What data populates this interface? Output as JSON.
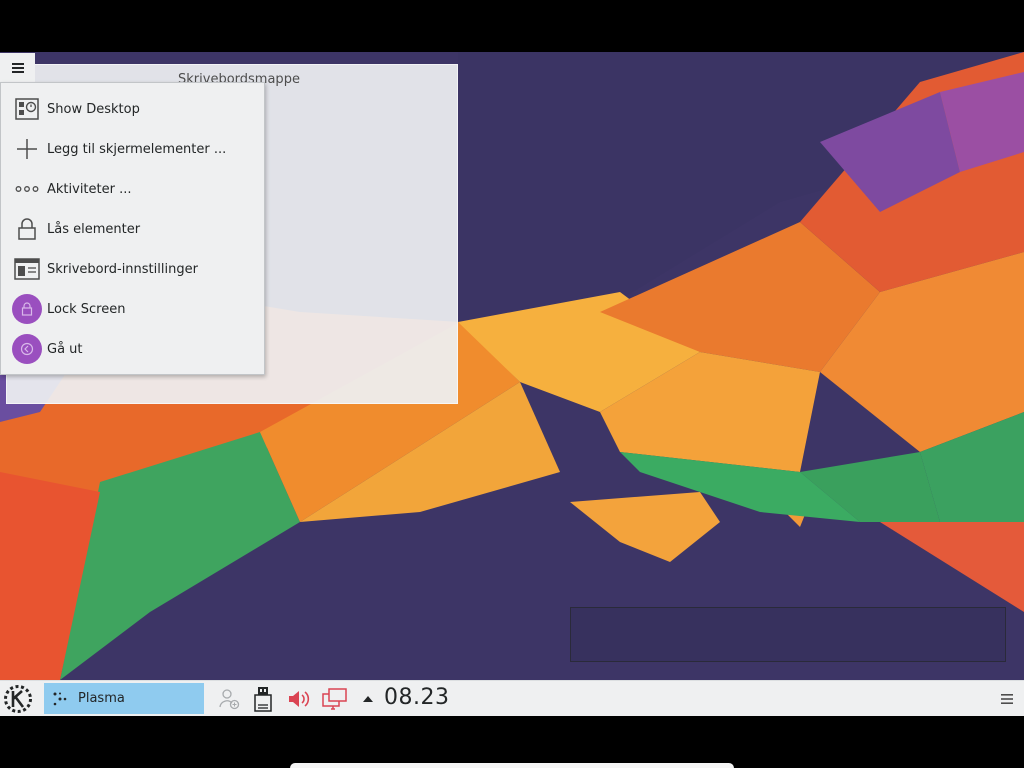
{
  "desktop": {
    "folder_widget": {
      "title": "Skrivebordsmappe"
    }
  },
  "context_menu": {
    "items": [
      {
        "label": "Show Desktop",
        "icon": "show-desktop-icon"
      },
      {
        "label": "Legg til skjermelementer ...",
        "icon": "plus-icon"
      },
      {
        "label": "Aktiviteter ...",
        "icon": "activities-icon"
      },
      {
        "label": "Lås elementer",
        "icon": "lock-icon"
      },
      {
        "label": "Skrivebord-innstillinger",
        "icon": "desktop-settings-icon"
      },
      {
        "label": "Lock Screen",
        "icon": "lock-screen-icon"
      },
      {
        "label": "Gå ut",
        "icon": "logout-icon"
      }
    ]
  },
  "panel": {
    "task": {
      "label": "Plasma"
    },
    "clock": "08.23",
    "tray_icons": [
      "user-switch-icon",
      "usb-drive-icon",
      "volume-icon",
      "network-icon",
      "tray-expand-icon"
    ]
  },
  "colors": {
    "panel_bg": "#eff0f1",
    "task_active": "#8fcbef",
    "accent_purple": "#9a4fbf",
    "volume_red": "#da4453"
  }
}
